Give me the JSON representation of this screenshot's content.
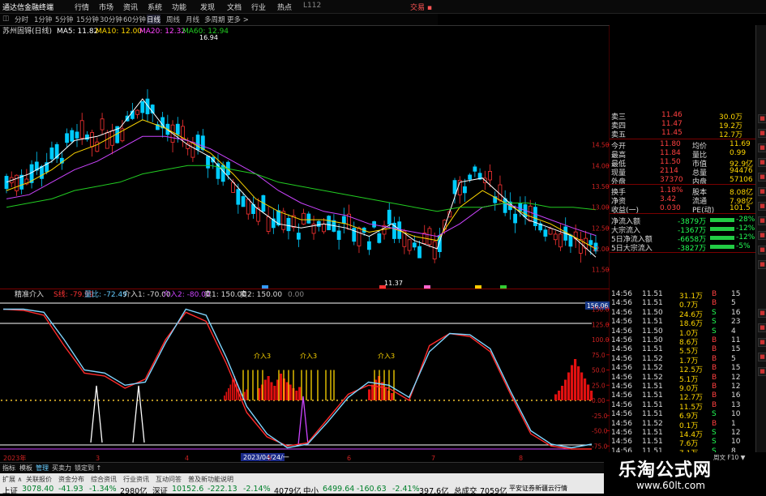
{
  "app": {
    "title": "通达信金融终端",
    "tradelink": "交易 ▪"
  },
  "menu": {
    "items": [
      "行情",
      "市场",
      "资讯",
      "系统",
      "功能",
      "发现",
      "文档",
      "行业",
      "热点",
      "L112"
    ]
  },
  "periods": [
    "分时",
    "1分钟",
    "5分钟",
    "15分钟",
    "30分钟",
    "60分钟",
    "日线",
    "周线",
    "月线",
    "多周期",
    "更多 >"
  ],
  "stock": {
    "name": "苏州固锝(日线)",
    "ma": [
      {
        "label": "MA5: 11.82",
        "color": "#ffffff"
      },
      {
        "label": "MA10: 12.00",
        "color": "#ffd700"
      },
      {
        "label": "MA20: 12.32",
        "color": "#ff44ff"
      },
      {
        "label": "MA60: 12.94",
        "color": "#00ff00"
      }
    ],
    "high_label": "16.94",
    "low_label": "11.37",
    "price_axis": [
      "14.50",
      "14.00",
      "13.50",
      "13.00",
      "12.50",
      "12.00",
      "11.50"
    ],
    "markers": [
      {
        "label": "财",
        "color": "#3399ff"
      },
      {
        "label": "息",
        "color": "#ff3333"
      },
      {
        "label": "权",
        "color": "#ff66cc"
      },
      {
        "label": "股",
        "color": "#ffcc00"
      },
      {
        "label": "减",
        "color": "#33cc33"
      }
    ]
  },
  "indicator": {
    "name": "精准介入",
    "params": [
      {
        "label": "S线: -79.99",
        "color": "#ff3333"
      },
      {
        "label": "量比: -72.49",
        "color": "#66ccff"
      },
      {
        "label": "介入1: -70.00",
        "color": "#dddddd"
      },
      {
        "label": "介入2: -80.00",
        "color": "#cc44ff"
      },
      {
        "label": "卖1: 150.00",
        "color": "#dddddd"
      },
      {
        "label": "卖2: 150.00",
        "color": "#dddddd"
      },
      {
        "label": "0.00",
        "color": "#888888"
      }
    ],
    "signals": [
      "介入3",
      "介入3",
      "介入3"
    ],
    "axis": [
      "156.06",
      "150.0",
      "125.0",
      "100.0",
      "75.0",
      "50.0",
      "25.0",
      "0.00",
      "-25.0",
      "-50.0",
      "-75.0"
    ],
    "xlabels": [
      "2023年",
      "3",
      "4",
      "5",
      "6",
      "7",
      "8"
    ],
    "date_box": "2023/04/24/一"
  },
  "quote": {
    "orders": [
      {
        "label": "卖三",
        "price": "11.46",
        "vol": "30.0万"
      },
      {
        "label": "卖四",
        "price": "11.47",
        "vol": "19.2万"
      },
      {
        "label": "卖五",
        "price": "11.45",
        "vol": "12.7万"
      }
    ],
    "stats": [
      {
        "l1": "今开",
        "v1": "11.80",
        "l2": "均价",
        "v2": "11.69"
      },
      {
        "l1": "最高",
        "v1": "11.84",
        "l2": "量比",
        "v2": "0.99"
      },
      {
        "l1": "最低",
        "v1": "11.50",
        "l2": "市值",
        "v2": "92.9亿"
      },
      {
        "l1": "现量",
        "v1": "2114",
        "l2": "总量",
        "v2": "94476"
      },
      {
        "l1": "外盘",
        "v1": "37370",
        "l2": "内盘",
        "v2": "57106"
      },
      {
        "l1": "换手",
        "v1": "1.18%",
        "l2": "股本",
        "v2": "8.08亿"
      },
      {
        "l1": "净资",
        "v1": "3.42",
        "l2": "流通",
        "v2": "7.98亿"
      },
      {
        "l1": "收益(一)",
        "v1": "0.030",
        "l2": "PE(动)",
        "v2": "101.5"
      }
    ],
    "flows": [
      {
        "label": "净流入额",
        "value": "-3879万",
        "pct": "-28%"
      },
      {
        "label": "大宗流入",
        "value": "-1367万",
        "pct": "-12%"
      },
      {
        "label": "5日净流入额",
        "value": "-6658万",
        "pct": "-12%"
      },
      {
        "label": "5日大宗流入",
        "value": "-3827万",
        "pct": "-5%"
      }
    ],
    "ticks": [
      {
        "t": "14:56",
        "p": "11.51",
        "v": "31.1万",
        "s": "B",
        "n": "15"
      },
      {
        "t": "14:56",
        "p": "11.51",
        "v": "0.7万",
        "s": "B",
        "n": "5"
      },
      {
        "t": "14:56",
        "p": "11.50",
        "v": "24.6万",
        "s": "S",
        "n": "16"
      },
      {
        "t": "14:56",
        "p": "11.51",
        "v": "18.6万",
        "s": "S",
        "n": "23"
      },
      {
        "t": "14:56",
        "p": "11.50",
        "v": "1.0万",
        "s": "S",
        "n": "4"
      },
      {
        "t": "14:56",
        "p": "11.50",
        "v": "8.6万",
        "s": "B",
        "n": "11"
      },
      {
        "t": "14:56",
        "p": "11.51",
        "v": "5.5万",
        "s": "B",
        "n": "15"
      },
      {
        "t": "14:56",
        "p": "11.52",
        "v": "1.7万",
        "s": "B",
        "n": "5"
      },
      {
        "t": "14:56",
        "p": "11.52",
        "v": "12.5万",
        "s": "B",
        "n": "15"
      },
      {
        "t": "14:56",
        "p": "11.52",
        "v": "5.1万",
        "s": "B",
        "n": "12"
      },
      {
        "t": "14:56",
        "p": "11.51",
        "v": "9.0万",
        "s": "B",
        "n": "12"
      },
      {
        "t": "14:56",
        "p": "11.51",
        "v": "12.7万",
        "s": "B",
        "n": "16"
      },
      {
        "t": "14:56",
        "p": "11.51",
        "v": "11.5万",
        "s": "B",
        "n": "13"
      },
      {
        "t": "14:56",
        "p": "11.51",
        "v": "6.9万",
        "s": "S",
        "n": "10"
      },
      {
        "t": "14:56",
        "p": "11.52",
        "v": "0.1万",
        "s": "B",
        "n": "1"
      },
      {
        "t": "14:56",
        "p": "11.51",
        "v": "14.4万",
        "s": "S",
        "n": "12"
      },
      {
        "t": "14:56",
        "p": "11.51",
        "v": "7.6万",
        "s": "S",
        "n": "10"
      },
      {
        "t": "14:56",
        "p": "11.51",
        "v": "7.1万",
        "s": "S",
        "n": "8"
      }
    ]
  },
  "tabs": [
    "指标",
    "模板",
    "管理",
    "买卖力",
    "锁定到 ↑"
  ],
  "bottom_tabs": [
    "扩展 ∧",
    "关联报价",
    "资金分布",
    "综合资讯",
    "行业资讯",
    "互动问答",
    "普及新功能说明",
    "周文 F10 ▼"
  ],
  "status": [
    {
      "label": "上证",
      "value": "3078.40",
      "chg": "-41.93",
      "pct": "-1.34%",
      "amt": "2980亿"
    },
    {
      "label": "深证",
      "value": "10152.6",
      "chg": "-222.13",
      "pct": "-2.14%",
      "amt": "4079亿"
    },
    {
      "label": "中小",
      "value": "6499.64",
      "chg": "-160.63",
      "pct": "-2.41%",
      "amt": "397.6亿"
    },
    {
      "label": "总成交",
      "value": "7059亿"
    },
    {
      "label": "平安证券新疆云行情"
    }
  ],
  "watermark": {
    "title": "乐淘公式网",
    "url": "www.60lt.com"
  },
  "colors": {
    "up": "#ff3333",
    "down": "#00ccff",
    "ma5": "#ffffff",
    "ma10": "#ffd700",
    "ma20": "#cc44ff",
    "ma60": "#22cc22"
  },
  "chart_data": [
    {
      "type": "line",
      "title": "苏州固锝(日线)",
      "series": [
        {
          "name": "MA5",
          "values": [
            13.6,
            13.8,
            14.1,
            14.6,
            14.7,
            14.9,
            15.6,
            14.9,
            14.5,
            14.2,
            13.6,
            13.0,
            12.6,
            12.5,
            12.6,
            12.5,
            12.3,
            12.6,
            12.2,
            12.0,
            13.6,
            13.7,
            13.2,
            12.7,
            12.5,
            12.3,
            11.8
          ]
        },
        {
          "name": "MA10",
          "values": [
            13.4,
            13.6,
            13.9,
            14.3,
            14.5,
            14.8,
            15.1,
            14.9,
            14.6,
            14.3,
            13.8,
            13.2,
            12.9,
            12.7,
            12.7,
            12.6,
            12.4,
            12.5,
            12.3,
            12.2,
            13.0,
            13.4,
            13.1,
            12.8,
            12.6,
            12.3,
            12.0
          ]
        },
        {
          "name": "MA20",
          "values": [
            13.2,
            13.3,
            13.6,
            13.9,
            14.1,
            14.4,
            14.7,
            14.7,
            14.6,
            14.4,
            14.1,
            13.8,
            13.4,
            13.1,
            12.9,
            12.8,
            12.6,
            12.5,
            12.4,
            12.3,
            12.6,
            13.0,
            13.1,
            12.9,
            12.7,
            12.5,
            12.32
          ]
        },
        {
          "name": "MA60",
          "values": [
            13.0,
            13.1,
            13.2,
            13.4,
            13.5,
            13.6,
            13.8,
            13.9,
            14.0,
            14.0,
            13.9,
            13.8,
            13.6,
            13.5,
            13.4,
            13.3,
            13.2,
            13.1,
            13.0,
            12.9,
            13.0,
            13.0,
            13.1,
            13.1,
            13.0,
            13.0,
            12.94
          ]
        }
      ],
      "ylim": [
        11.3,
        17.1
      ],
      "annotations": [
        "16.94",
        "11.37"
      ]
    },
    {
      "type": "line",
      "title": "精准介入",
      "series": [
        {
          "name": "S线",
          "values": [
            150,
            148,
            140,
            90,
            45,
            40,
            20,
            35,
            100,
            145,
            130,
            60,
            -20,
            -60,
            -75,
            -70,
            -30,
            10,
            25,
            20,
            0,
            90,
            110,
            105,
            80,
            10,
            -55,
            -75,
            -80,
            -80
          ]
        },
        {
          "name": "量比",
          "values": [
            150,
            150,
            145,
            100,
            50,
            45,
            25,
            30,
            95,
            150,
            140,
            70,
            -10,
            -55,
            -78,
            -72,
            -35,
            5,
            30,
            25,
            5,
            80,
            110,
            108,
            85,
            15,
            -50,
            -72,
            -78,
            -72
          ]
        }
      ],
      "ylim": [
        -80,
        160
      ]
    }
  ]
}
